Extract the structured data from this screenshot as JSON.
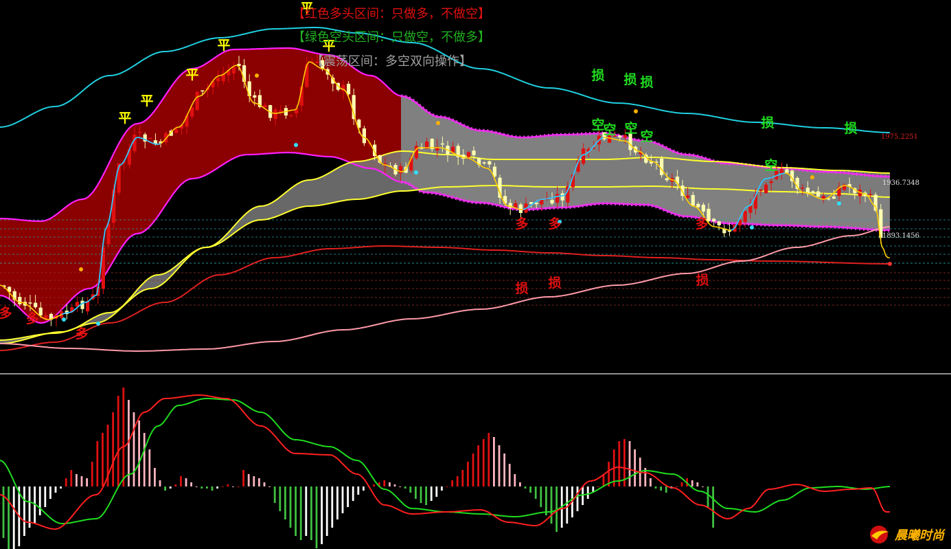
{
  "legend": {
    "red": "【红色多头区间：只做多，不做空】",
    "green": "【绿色空头区间：只做空，不做多】",
    "gray": "【震荡区间：多空双向操作】"
  },
  "brand": {
    "text": "晨曦时尚",
    "logo_icon": "sun-bird-logo"
  },
  "colors": {
    "background": "#000000",
    "bull_zone": "#8b0000",
    "range_zone": "#808080",
    "candle_up": "#e01010",
    "candle_down": "#ffffb0",
    "macd_pos": "#e01010",
    "macd_pos_fade": "#ffb6c1",
    "macd_neg": "#40c040",
    "macd_neg_fade": "#ffffff",
    "line_red": "#ff2020",
    "line_green": "#20dd20",
    "signal_buy": "#e01010",
    "signal_sell": "#20dd20",
    "signal_flat": "#ffff00"
  },
  "chart_data": {
    "type": "line",
    "price_labels": [
      "1975.2251",
      "1936.7348",
      "1893.1456"
    ],
    "signals": [
      {
        "text": "多",
        "kind": "buy"
      },
      {
        "text": "多",
        "kind": "buy"
      },
      {
        "text": "多",
        "kind": "buy"
      },
      {
        "text": "多",
        "kind": "buy"
      },
      {
        "text": "多",
        "kind": "buy"
      },
      {
        "text": "多",
        "kind": "buy"
      },
      {
        "text": "平",
        "kind": "flat"
      },
      {
        "text": "平",
        "kind": "flat"
      },
      {
        "text": "平",
        "kind": "flat"
      },
      {
        "text": "平",
        "kind": "flat"
      },
      {
        "text": "平",
        "kind": "flat"
      },
      {
        "text": "平",
        "kind": "flat"
      },
      {
        "text": "空",
        "kind": "sell"
      },
      {
        "text": "空",
        "kind": "sell"
      },
      {
        "text": "空",
        "kind": "sell"
      },
      {
        "text": "空",
        "kind": "sell"
      },
      {
        "text": "空",
        "kind": "sell"
      },
      {
        "text": "损",
        "kind": "sell"
      },
      {
        "text": "损",
        "kind": "sell"
      },
      {
        "text": "损",
        "kind": "sell"
      },
      {
        "text": "损",
        "kind": "sell"
      },
      {
        "text": "损",
        "kind": "sell"
      },
      {
        "text": "损",
        "kind": "buy"
      },
      {
        "text": "损",
        "kind": "buy"
      },
      {
        "text": "损",
        "kind": "buy"
      }
    ],
    "macd_bars": [
      -2.5,
      -3.8,
      -3.2,
      -2.9,
      -2.4,
      -2.0,
      -1.8,
      -1.4,
      -1.0,
      -0.6,
      -0.3,
      -0.1,
      0.4,
      0.8,
      0.6,
      0.5,
      0.4,
      1.2,
      2.2,
      2.6,
      3.0,
      3.6,
      4.4,
      4.8,
      4.2,
      3.6,
      3.2,
      2.6,
      1.8,
      0.9,
      0.3,
      -0.2,
      -0.1,
      0.1,
      0.5,
      0.4,
      0.2,
      0.0,
      -0.1,
      -0.1,
      -0.2,
      -0.1,
      0.0,
      0.1,
      0.0,
      0.0,
      0.8,
      0.6,
      0.5,
      0.4,
      0.2,
      0.0,
      -0.8,
      -1.2,
      -1.6,
      -2.0,
      -2.4,
      -2.6,
      -2.4,
      -2.6,
      -3.0,
      -2.8,
      -2.4,
      -2.0,
      -1.6,
      -1.3,
      -1.0,
      -0.7,
      -0.4,
      -0.2,
      0.0,
      0.1,
      0.2,
      0.3,
      0.2,
      0.1,
      0.0,
      -0.1,
      -0.3,
      -0.6,
      -0.8,
      -0.9,
      -0.7,
      -0.5,
      -0.2,
      0.0,
      0.3,
      0.5,
      0.8,
      1.2,
      1.6,
      2.0,
      2.3,
      2.6,
      2.4,
      2.0,
      1.6,
      1.1,
      0.6,
      0.2,
      -0.1,
      -0.3,
      -0.6,
      -1.0,
      -1.4,
      -1.8,
      -2.2,
      -2.0,
      -1.8,
      -1.5,
      -1.2,
      -0.9,
      -0.6,
      -0.3,
      0.0,
      0.6,
      1.2,
      1.8,
      2.2,
      2.3,
      2.2,
      1.8,
      1.4,
      0.9,
      0.4,
      -0.1,
      -0.2,
      -0.3,
      -0.1,
      0.0,
      0.2,
      0.4,
      0.3,
      0.2,
      0.0,
      -1.0,
      -2.0
    ]
  }
}
